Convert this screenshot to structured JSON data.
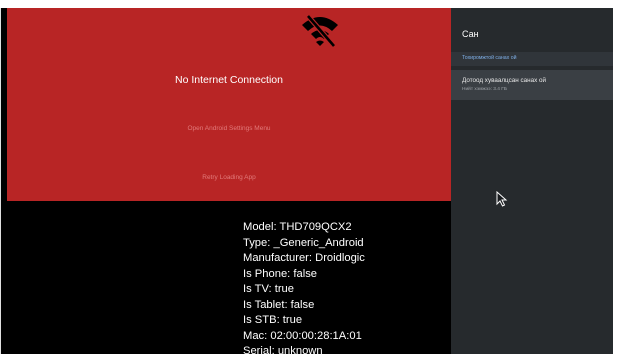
{
  "main": {
    "title": "No Internet Connection",
    "open_settings_label": "Open Android Settings Menu",
    "retry_label": "Retry Loading App",
    "icon": "wifi-off-icon"
  },
  "device_info": [
    "Model: THD709QCX2",
    "Type: _Generic_Android",
    "Manufacturer: Droidlogic",
    "Is Phone: false",
    "Is TV: true",
    "Is Tablet: false",
    "Is STB: true",
    "Mac: 02:00:00:28:1A:01",
    "Serial: unknown"
  ],
  "side_panel": {
    "title": "Сан",
    "section_header": "Тохиромжтой санах ой",
    "items": [
      {
        "label": "Дотоод хуваалцсан санах ой",
        "sub": "Нийт хэмжээ: 3.4 ГБ"
      }
    ]
  },
  "colors": {
    "red_panel": "#b82525",
    "side_panel": "#262a2d",
    "accent_text": "#7fb0e8"
  }
}
